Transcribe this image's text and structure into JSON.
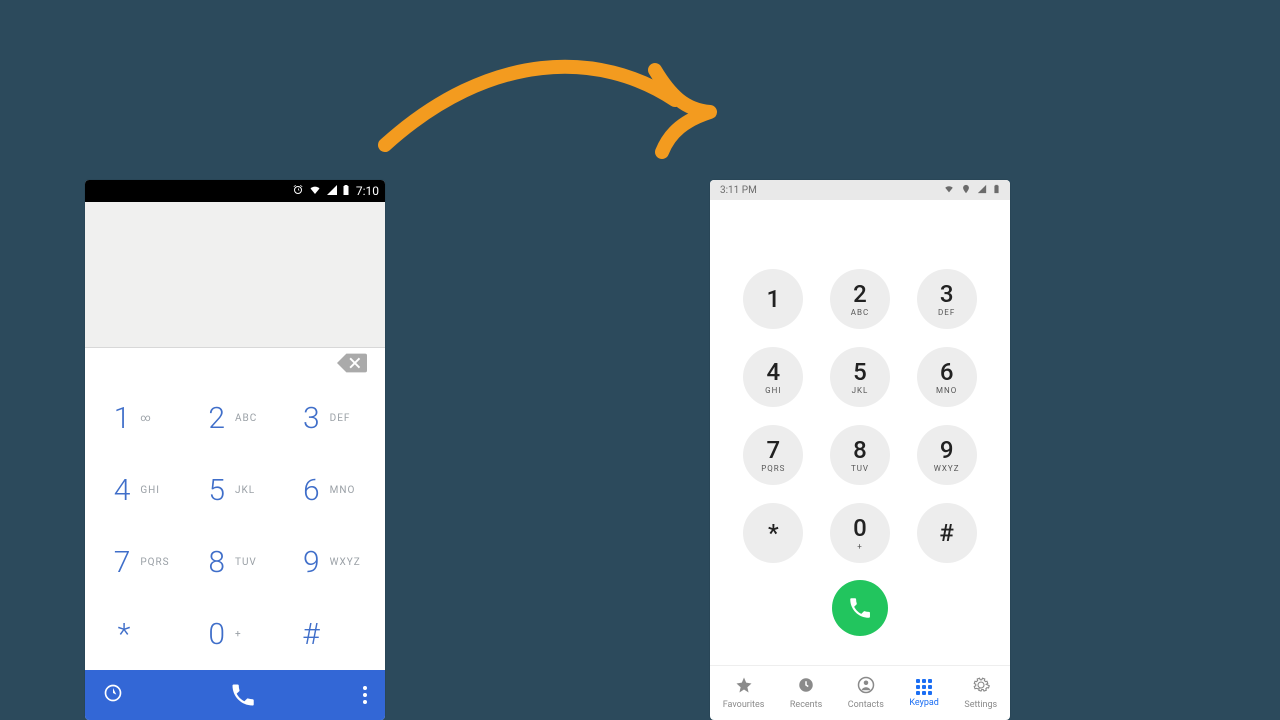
{
  "arrow_color": "#f39b1f",
  "phoneA": {
    "status": {
      "time": "7:10"
    },
    "keys": [
      {
        "digit": "1",
        "letters": "∞"
      },
      {
        "digit": "2",
        "letters": "ABC"
      },
      {
        "digit": "3",
        "letters": "DEF"
      },
      {
        "digit": "4",
        "letters": "GHI"
      },
      {
        "digit": "5",
        "letters": "JKL"
      },
      {
        "digit": "6",
        "letters": "MNO"
      },
      {
        "digit": "7",
        "letters": "PQRS"
      },
      {
        "digit": "8",
        "letters": "TUV"
      },
      {
        "digit": "9",
        "letters": "WXYZ"
      },
      {
        "digit": "*",
        "letters": ""
      },
      {
        "digit": "0",
        "letters": "+"
      },
      {
        "digit": "#",
        "letters": ""
      }
    ]
  },
  "phoneB": {
    "status": {
      "time": "3:11 PM"
    },
    "keys": [
      {
        "digit": "1",
        "letters": ""
      },
      {
        "digit": "2",
        "letters": "ABC"
      },
      {
        "digit": "3",
        "letters": "DEF"
      },
      {
        "digit": "4",
        "letters": "GHI"
      },
      {
        "digit": "5",
        "letters": "JKL"
      },
      {
        "digit": "6",
        "letters": "MNO"
      },
      {
        "digit": "7",
        "letters": "PQRS"
      },
      {
        "digit": "8",
        "letters": "TUV"
      },
      {
        "digit": "9",
        "letters": "WXYZ"
      },
      {
        "digit": "*",
        "letters": ""
      },
      {
        "digit": "0",
        "letters": "+"
      },
      {
        "digit": "#",
        "letters": ""
      }
    ],
    "tabs": [
      {
        "id": "favourites",
        "label": "Favourites",
        "icon": "star-icon",
        "active": false
      },
      {
        "id": "recents",
        "label": "Recents",
        "icon": "clock-icon",
        "active": false
      },
      {
        "id": "contacts",
        "label": "Contacts",
        "icon": "person-icon",
        "active": false
      },
      {
        "id": "keypad",
        "label": "Keypad",
        "icon": "keypad-icon",
        "active": true
      },
      {
        "id": "settings",
        "label": "Settings",
        "icon": "gear-icon",
        "active": false
      }
    ]
  }
}
